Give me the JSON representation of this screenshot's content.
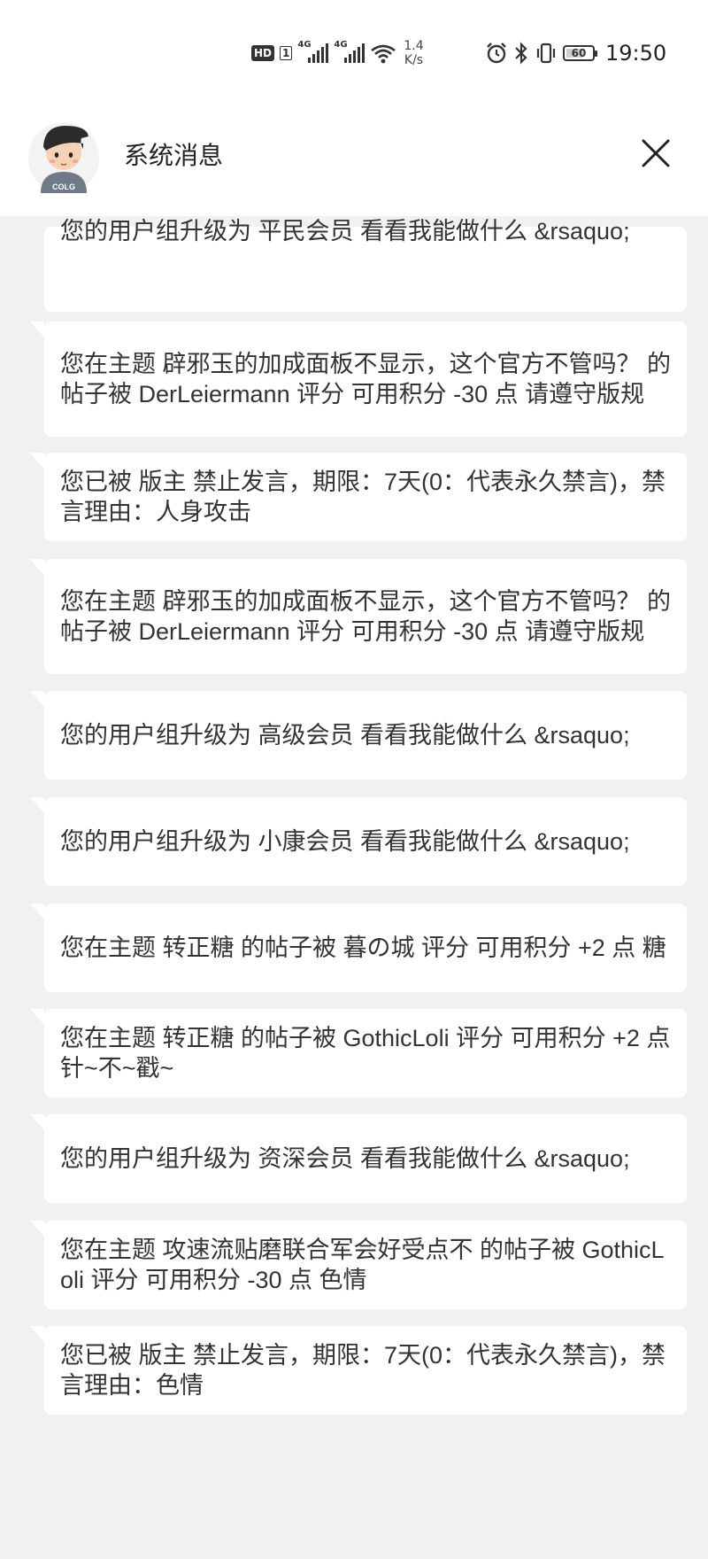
{
  "status_bar": {
    "hd_label": "HD",
    "sim_label": "1",
    "signal1_tag": "4G",
    "signal2_tag": "4G",
    "net_speed_value": "1.4",
    "net_speed_unit": "K/s",
    "battery_level": "60",
    "time": "19:50",
    "icons": [
      "alarm-icon",
      "bluetooth-icon",
      "vibrate-icon",
      "battery-icon",
      "wifi-icon",
      "signal-icon"
    ]
  },
  "header": {
    "title": "系统消息",
    "avatar_text": "COLG",
    "close_icon": "close-icon"
  },
  "messages": [
    {
      "text": "您的用户组升级为 平民会员  看看我能做什么 &rsaquo;"
    },
    {
      "text": "您在主题 辟邪玉的加成面板不显示，这个官方不管吗？ 的帖子被 DerLeiermann 评分 可用积分 -30 点 请遵守版规"
    },
    {
      "text": "您已被 版主 禁止发言，期限：7天(0：代表永久禁言)，禁言理由：人身攻击"
    },
    {
      "text": "您在主题 辟邪玉的加成面板不显示，这个官方不管吗？ 的帖子被 DerLeiermann 评分 可用积分 -30 点 请遵守版规"
    },
    {
      "text": "您的用户组升级为 高级会员  看看我能做什么 &rsaquo;"
    },
    {
      "text": "您的用户组升级为 小康会员  看看我能做什么 &rsaquo;"
    },
    {
      "text": "您在主题 转正糖 的帖子被 暮の城 评分 可用积分 +2 点 糖"
    },
    {
      "text": "您在主题 转正糖 的帖子被 GothicLoli 评分 可用积分 +2 点 针~不~戳~"
    },
    {
      "text": "您的用户组升级为 资深会员  看看我能做什么 &rsaquo;"
    },
    {
      "text": "您在主题 攻速流贴磨联合军会好受点不 的帖子被 GothicLoli 评分 可用积分 -30 点 色情"
    },
    {
      "text": "您已被 版主 禁止发言，期限：7天(0：代表永久禁言)，禁言理由：色情"
    }
  ]
}
